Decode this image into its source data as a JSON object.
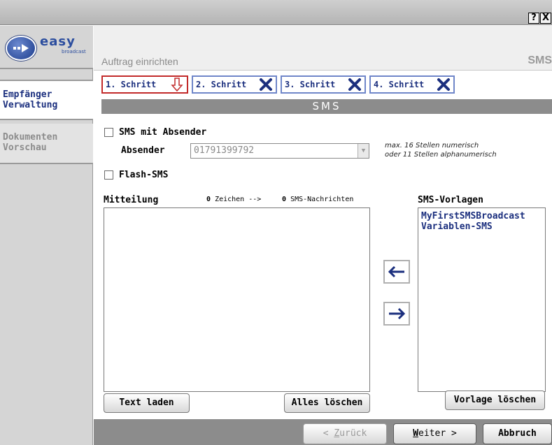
{
  "window": {
    "help_glyph": "?",
    "close_glyph": "X"
  },
  "brand": {
    "wordmark": "easy",
    "subtext": "broadcast"
  },
  "sidebar": {
    "items": [
      {
        "label_line1": "Empfänger",
        "label_line2": "Verwaltung",
        "state": "active"
      },
      {
        "label_line1": "Dokumenten",
        "label_line2": "Vorschau",
        "state": "inactive"
      }
    ]
  },
  "header": {
    "title": "Auftrag einrichten",
    "code": "SMS"
  },
  "steps": [
    {
      "label": "1. Schritt",
      "status": "current",
      "icon": "down-arrow-icon"
    },
    {
      "label": "2. Schritt",
      "status": "pending",
      "icon": "x-icon"
    },
    {
      "label": "3. Schritt",
      "status": "pending",
      "icon": "x-icon"
    },
    {
      "label": "4. Schritt",
      "status": "pending",
      "icon": "x-icon"
    }
  ],
  "section": {
    "title": "SMS"
  },
  "form": {
    "sms_sender_checkbox": {
      "label": "SMS mit Absender",
      "checked": false
    },
    "sender": {
      "label": "Absender",
      "value": "01791399792"
    },
    "sender_hint_line1": "max. 16 Stellen numerisch",
    "sender_hint_line2": "oder 11 Stellen alphanumerisch",
    "flash_checkbox": {
      "label": "Flash-SMS",
      "checked": false
    }
  },
  "message": {
    "label": "Mitteilung",
    "char_count": "0",
    "char_label": "Zeichen -->",
    "sms_count": "0",
    "sms_label": "SMS-Nachrichten",
    "value": ""
  },
  "templates": {
    "label": "SMS-Vorlagen",
    "items": [
      "MyFirstSMSBroadcast",
      "Variablen-SMS"
    ]
  },
  "buttons": {
    "load_text": "Text laden",
    "clear_all": "Alles löschen",
    "delete_template": "Vorlage löschen",
    "move_left_icon": "arrow-left-icon",
    "move_right_icon": "arrow-right-icon"
  },
  "footer": {
    "back_prefix": "< ",
    "back_hotkey": "Z",
    "back_rest": "urück",
    "next_hotkey": "W",
    "next_rest": "eiter >",
    "cancel": "Abbruch"
  },
  "colors": {
    "accent_blue": "#1b2f7e",
    "step_active_border": "#c22a2a",
    "step_border": "#6f86c9",
    "bar_gray": "#8c8c8c"
  }
}
